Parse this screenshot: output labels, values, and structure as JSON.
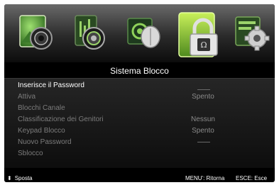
{
  "menu_icons": [
    {
      "icon": "picture-camera-icon",
      "selected": false
    },
    {
      "icon": "sound-speaker-icon",
      "selected": false
    },
    {
      "icon": "channel-satellite-icon",
      "selected": false
    },
    {
      "icon": "lock-icon",
      "selected": true
    },
    {
      "icon": "settings-gear-icon",
      "selected": false
    }
  ],
  "title": "Sistema Blocco",
  "rows": [
    {
      "label": "Inserisce il Password",
      "value": ""
    },
    {
      "label": "Attiva",
      "value": "Spento"
    },
    {
      "label": "Blocchi Canale",
      "value": ""
    },
    {
      "label": "Classificazione dei Genitori",
      "value": "Nessun"
    },
    {
      "label": "Keypad Blocco",
      "value": "Spento"
    },
    {
      "label": "Nuovo Password",
      "value": ""
    },
    {
      "label": "Sblocco",
      "value": ""
    }
  ],
  "footer": {
    "move_icon": "up-down-arrows-icon",
    "move": "Sposta",
    "back": "MENU': Ritorna",
    "exit": "ESCE: Esce"
  },
  "colors": {
    "accent": "#c9f05a",
    "selected_tile": "#7dbb2a"
  }
}
